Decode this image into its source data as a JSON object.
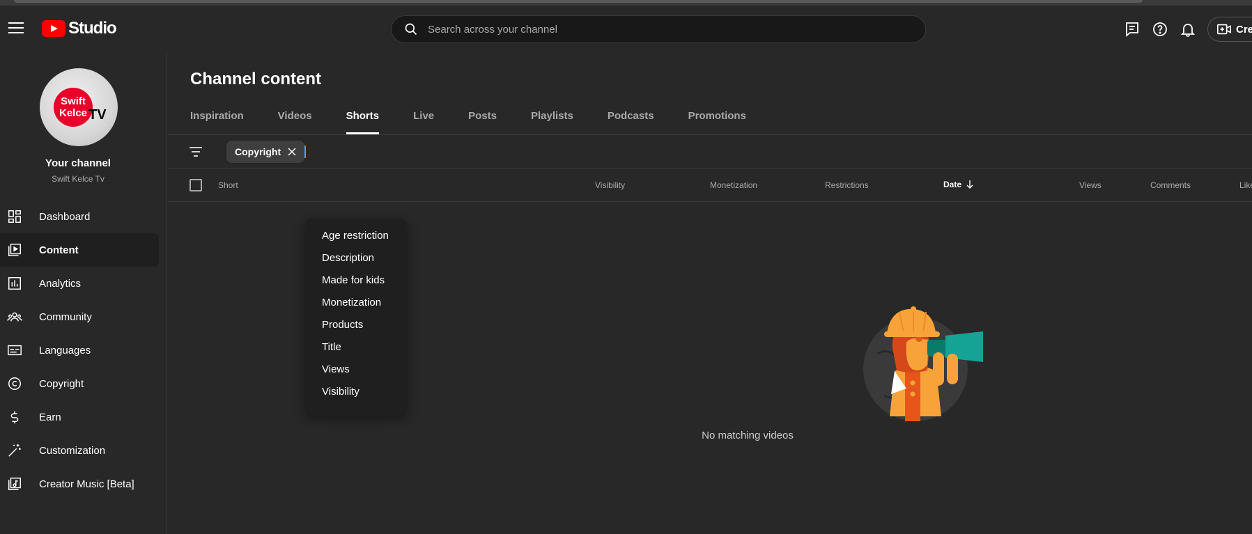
{
  "app": {
    "logo_text": "Studio"
  },
  "search": {
    "placeholder": "Search across your channel"
  },
  "header": {
    "create_label": "Create"
  },
  "sidebar": {
    "channel_label": "Your channel",
    "channel_name": "Swift Kelce Tv",
    "avatar_text_1": "Swift",
    "avatar_text_2": "Kelce",
    "avatar_text_3": "TV",
    "items": [
      {
        "label": "Dashboard",
        "icon": "dashboard-icon"
      },
      {
        "label": "Content",
        "icon": "content-icon",
        "active": true
      },
      {
        "label": "Analytics",
        "icon": "analytics-icon"
      },
      {
        "label": "Community",
        "icon": "community-icon"
      },
      {
        "label": "Languages",
        "icon": "subtitles-icon"
      },
      {
        "label": "Copyright",
        "icon": "copyright-icon"
      },
      {
        "label": "Earn",
        "icon": "dollar-icon"
      },
      {
        "label": "Customization",
        "icon": "magic-wand-icon"
      },
      {
        "label": "Creator Music [Beta]",
        "icon": "music-library-icon"
      }
    ]
  },
  "main": {
    "title": "Channel content",
    "tabs": [
      {
        "label": "Inspiration"
      },
      {
        "label": "Videos"
      },
      {
        "label": "Shorts",
        "active": true
      },
      {
        "label": "Live"
      },
      {
        "label": "Posts"
      },
      {
        "label": "Playlists"
      },
      {
        "label": "Podcasts"
      },
      {
        "label": "Promotions"
      }
    ],
    "filter_chip": "Copyright",
    "columns": {
      "short": "Short",
      "visibility": "Visibility",
      "monetization": "Monetization",
      "restrictions": "Restrictions",
      "date": "Date",
      "views": "Views",
      "comments": "Comments",
      "likes": "Likes"
    },
    "filter_menu": [
      "Age restriction",
      "Description",
      "Made for kids",
      "Monetization",
      "Products",
      "Title",
      "Views",
      "Visibility"
    ],
    "empty_text": "No matching videos"
  },
  "colors": {
    "accent": "#3ea6ff",
    "brand": "#ff0000",
    "background": "#282828"
  }
}
